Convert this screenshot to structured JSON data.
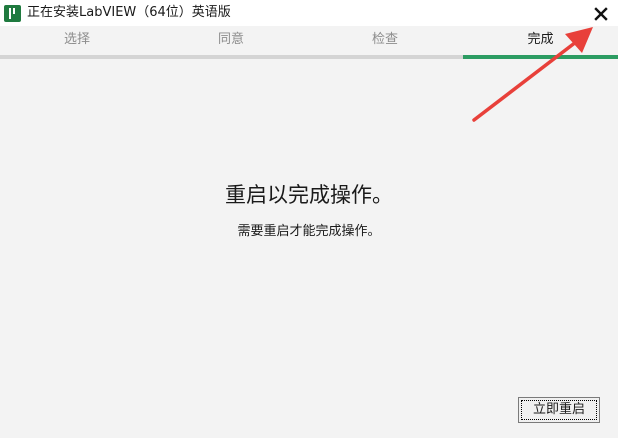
{
  "window": {
    "title": "正在安装LabVIEW（64位）英语版",
    "icon": "labview-installer-icon",
    "close_icon": "close-icon"
  },
  "tabs": [
    {
      "label": "选择",
      "active": false
    },
    {
      "label": "同意",
      "active": false
    },
    {
      "label": "检查",
      "active": false
    },
    {
      "label": "完成",
      "active": true
    }
  ],
  "main": {
    "headline": "重启以完成操作。",
    "message": "需要重启才能完成操作。"
  },
  "footer": {
    "restart_label": "立即重启"
  },
  "annotation": {
    "arrow_color": "#e8403a",
    "points_to": "close-icon"
  },
  "colors": {
    "accent": "#2c9c62",
    "background": "#f3f3f3"
  }
}
